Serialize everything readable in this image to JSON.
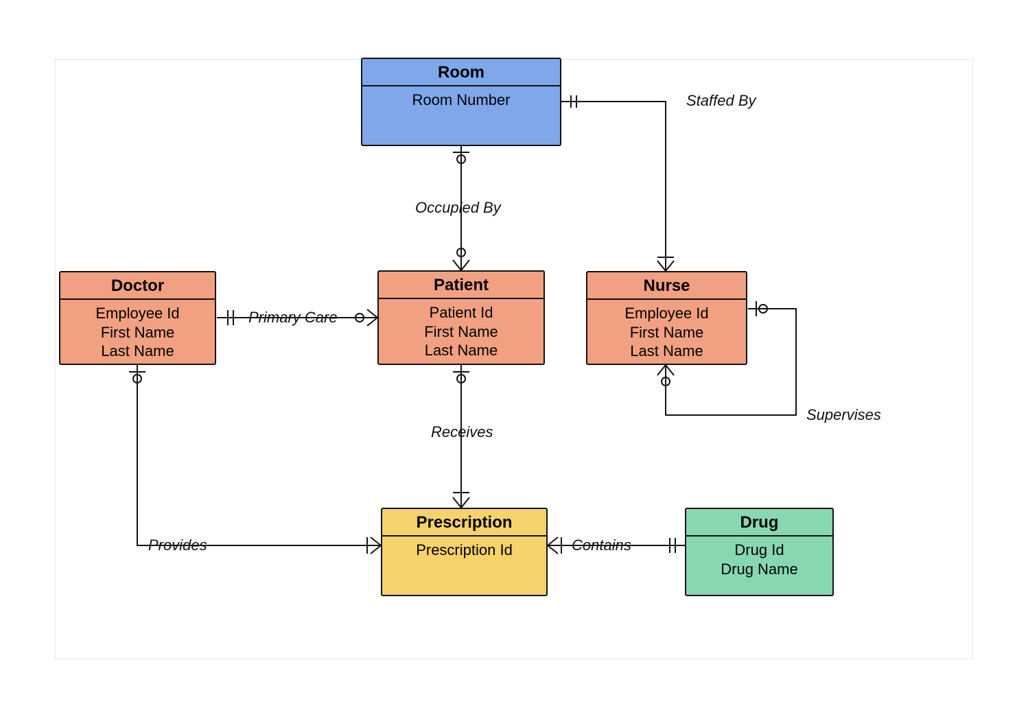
{
  "entities": {
    "room": {
      "title": "Room",
      "attrs": [
        "Room Number"
      ]
    },
    "doctor": {
      "title": "Doctor",
      "attrs": [
        "Employee Id",
        "First Name",
        "Last Name"
      ]
    },
    "patient": {
      "title": "Patient",
      "attrs": [
        "Patient Id",
        "First Name",
        "Last Name"
      ]
    },
    "nurse": {
      "title": "Nurse",
      "attrs": [
        "Employee Id",
        "First Name",
        "Last Name"
      ]
    },
    "prescription": {
      "title": "Prescription",
      "attrs": [
        "Prescription Id"
      ]
    },
    "drug": {
      "title": "Drug",
      "attrs": [
        "Drug Id",
        "Drug Name"
      ]
    }
  },
  "relationships": {
    "staffed_by": {
      "label": "Staffed By"
    },
    "occupied_by": {
      "label": "Occupied By"
    },
    "primary_care": {
      "label": "Primary Care"
    },
    "supervises": {
      "label": "Supervises"
    },
    "receives": {
      "label": "Receives"
    },
    "provides": {
      "label": "Provides"
    },
    "contains": {
      "label": "Contains"
    }
  },
  "colors": {
    "blue": "#7fa7ea",
    "orange": "#f1a182",
    "yellow": "#f6d26b",
    "green": "#87d8b0"
  }
}
